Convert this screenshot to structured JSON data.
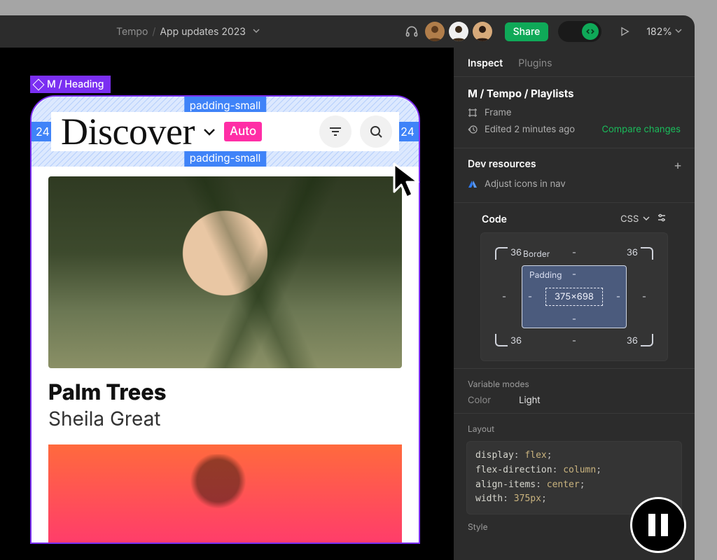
{
  "topbar": {
    "breadcrumb_parent": "Tempo",
    "breadcrumb_page": "App updates 2023",
    "share_label": "Share",
    "zoom_label": "182%"
  },
  "canvas": {
    "selection_tag": "M / Heading",
    "discover_heading": "Discover",
    "auto_badge": "Auto",
    "measure_left": "24",
    "measure_right": "24",
    "padding_top_label": "padding-small",
    "padding_bottom_label": "padding-small",
    "song_title": "Palm Trees",
    "song_artist": "Sheila Great"
  },
  "inspector": {
    "tabs": {
      "inspect": "Inspect",
      "plugins": "Plugins"
    },
    "selection_path": "M / Tempo / Playlists",
    "node_type": "Frame",
    "edited_ago": "Edited 2 minutes ago",
    "compare": "Compare changes",
    "dev_resources_title": "Dev resources",
    "dev_resource_item": "Adjust icons in nav",
    "code_title": "Code",
    "lang": "CSS",
    "boxmodel": {
      "border_label": "Border",
      "outer_tl": "36",
      "outer_tr": "36",
      "outer_bl": "36",
      "outer_br": "36",
      "padding_label": "Padding",
      "dims": "375×698"
    },
    "variable_modes_title": "Variable modes",
    "var_color_key": "Color",
    "var_color_value": "Light",
    "layout_title": "Layout",
    "css": {
      "l1p": "display",
      "l1v": "flex",
      "l2p": "flex-direction",
      "l2v": "column",
      "l3p": "align-items",
      "l3v": "center",
      "l4p": "width",
      "l4v": "375px"
    },
    "style_title": "Style"
  }
}
